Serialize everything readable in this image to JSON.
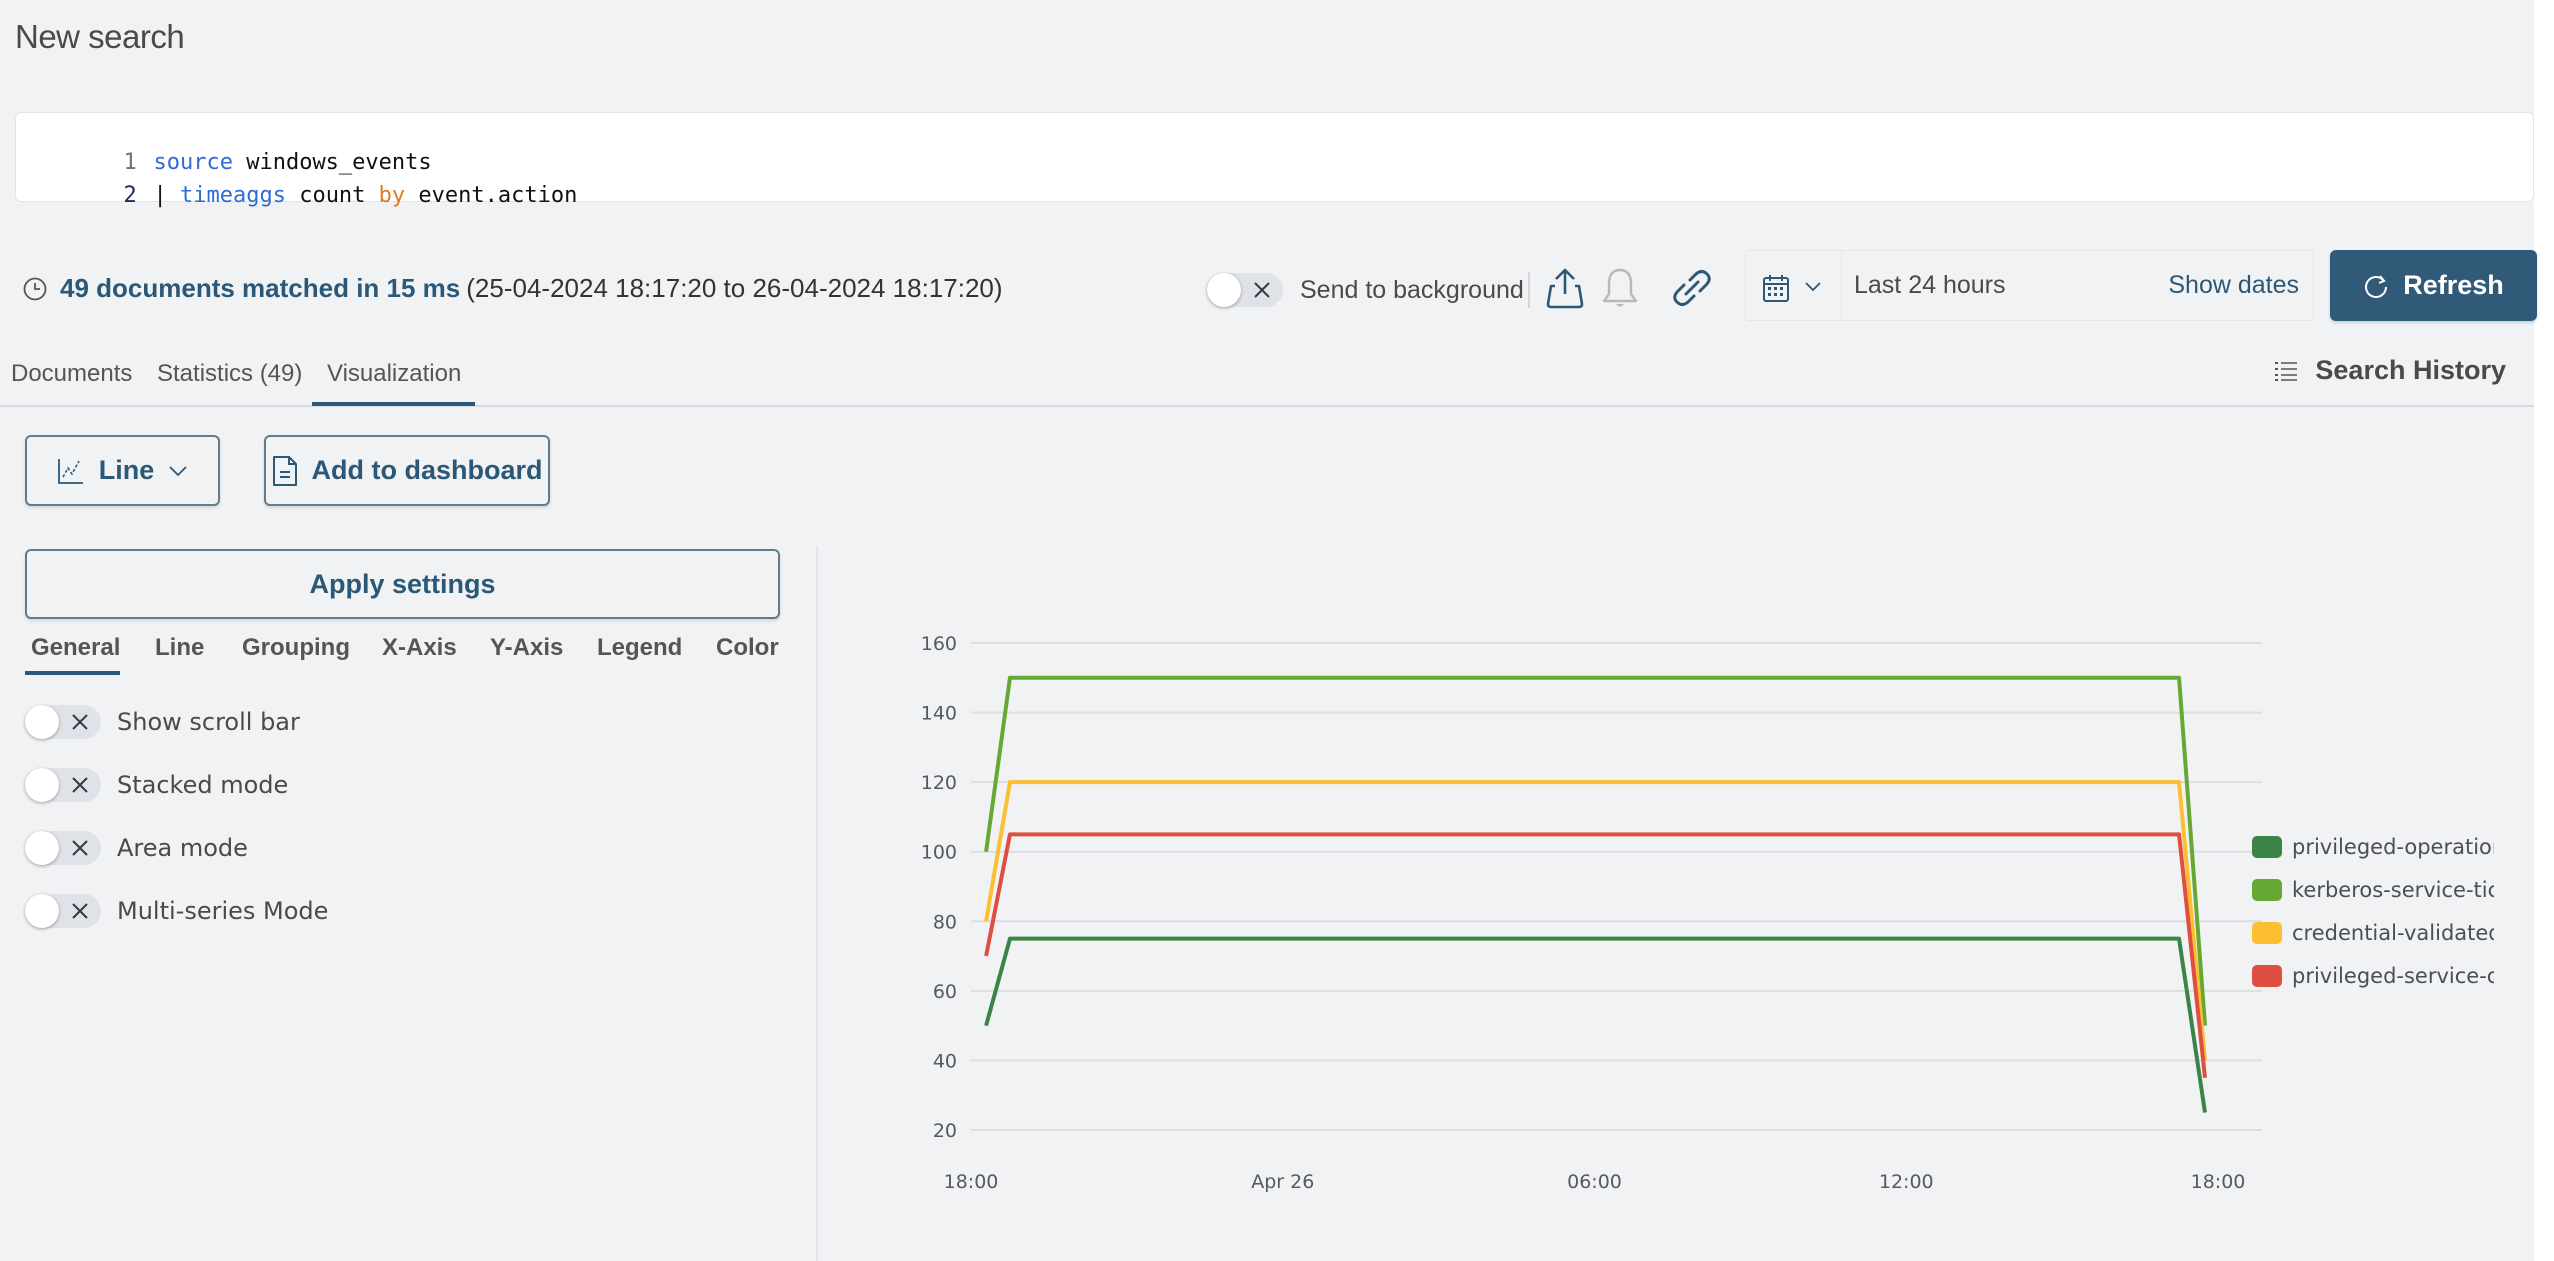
{
  "page": {
    "title": "New search"
  },
  "query": {
    "lines": [
      {
        "number": "1",
        "tokens": [
          {
            "text": "source",
            "style": "blue"
          },
          {
            "text": " windows_events",
            "style": "plain"
          }
        ]
      },
      {
        "number": "2",
        "tokens": [
          {
            "text": "| ",
            "style": "plain"
          },
          {
            "text": "timeaggs",
            "style": "blue"
          },
          {
            "text": " count ",
            "style": "plain"
          },
          {
            "text": "by",
            "style": "orange"
          },
          {
            "text": " event.action",
            "style": "plain"
          }
        ]
      }
    ]
  },
  "status": {
    "icon": "clock-icon",
    "summary": "49 documents matched in 15 ms",
    "range": "(25-04-2024 18:17:20 to 26-04-2024 18:17:20)"
  },
  "toolbar": {
    "send_to_background": {
      "label": "Send to background",
      "enabled": false
    },
    "export_icon": "share-upload-icon",
    "alert_icon": "bell-icon",
    "link_icon": "link-icon"
  },
  "datepicker": {
    "icon": "calendar-icon",
    "range_label": "Last 24 hours",
    "show_dates_label": "Show dates"
  },
  "refresh": {
    "label": "Refresh",
    "icon": "refresh-icon"
  },
  "tabs": {
    "items": [
      {
        "label": "Documents"
      },
      {
        "label": "Statistics (49)"
      },
      {
        "label": "Visualization",
        "active": true
      }
    ],
    "search_history_label": "Search History"
  },
  "viz": {
    "chart_type_label": "Line",
    "add_to_dashboard_label": "Add to dashboard",
    "apply_settings_label": "Apply settings",
    "settings_tabs": [
      "General",
      "Line",
      "Grouping",
      "X-Axis",
      "Y-Axis",
      "Legend",
      "Color"
    ],
    "active_settings_tab": "General",
    "options": [
      {
        "label": "Show scroll bar",
        "enabled": false
      },
      {
        "label": "Stacked mode",
        "enabled": false
      },
      {
        "label": "Area mode",
        "enabled": false
      },
      {
        "label": "Multi-series Mode",
        "enabled": false
      }
    ]
  },
  "chart_data": {
    "type": "line",
    "title": "",
    "xlabel": "",
    "ylabel": "",
    "x_ticks": [
      "18:00",
      "Apr 26",
      "06:00",
      "12:00",
      "18:00"
    ],
    "x_range_hours": [
      0,
      24
    ],
    "x": [
      0.29,
      0.75,
      23.25,
      23.75
    ],
    "ylim": [
      20,
      160
    ],
    "y_ticks": [
      20,
      40,
      60,
      80,
      100,
      120,
      140,
      160
    ],
    "grid": true,
    "legend_position": "right",
    "series": [
      {
        "name": "privileged-operation",
        "color": "#3b8447",
        "values": [
          50,
          75,
          75,
          25
        ]
      },
      {
        "name": "kerberos-service-ticket",
        "color": "#67a835",
        "values": [
          100,
          150,
          150,
          50
        ]
      },
      {
        "name": "credential-validated",
        "color": "#fbbf31",
        "values": [
          80,
          120,
          120,
          40
        ]
      },
      {
        "name": "privileged-service-called",
        "color": "#de4f41",
        "values": [
          70,
          105,
          105,
          35
        ]
      }
    ],
    "legend_labels": [
      "privileged-operation",
      "kerberos-service-tic",
      "credential-validated",
      "privileged-service-c"
    ]
  }
}
